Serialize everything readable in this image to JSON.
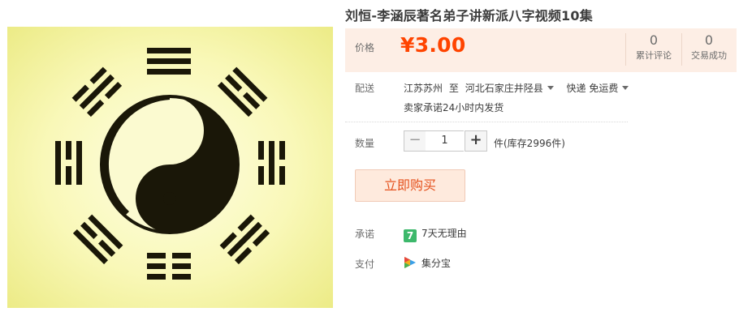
{
  "product": {
    "title": "刘恒-李涵辰著名弟子讲新派八字视频10集"
  },
  "price": {
    "label": "价格",
    "value": "¥3.00",
    "color": "#ff4400",
    "panel_color": "#fdeee5"
  },
  "stats": {
    "reviews": {
      "count": "0",
      "label": "累计评论"
    },
    "sales": {
      "count": "0",
      "label": "交易成功"
    }
  },
  "shipping": {
    "label": "配送",
    "from": "江苏苏州",
    "to_word": "至",
    "destination": "河北石家庄井陉县",
    "method": "快递 免运费",
    "promise": "卖家承诺24小时内发货"
  },
  "quantity": {
    "label": "数量",
    "value": "1",
    "minus": "−",
    "plus": "+",
    "stock_text": "件(库存2996件)"
  },
  "buy_button": {
    "label": "立即购买"
  },
  "guarantee": {
    "label": "承诺",
    "icon": "seven-day-return-icon",
    "badge_glyph": "7",
    "text": "7天无理由"
  },
  "payment": {
    "label": "支付",
    "icon": "jifenbao-icon",
    "text": "集分宝"
  }
}
